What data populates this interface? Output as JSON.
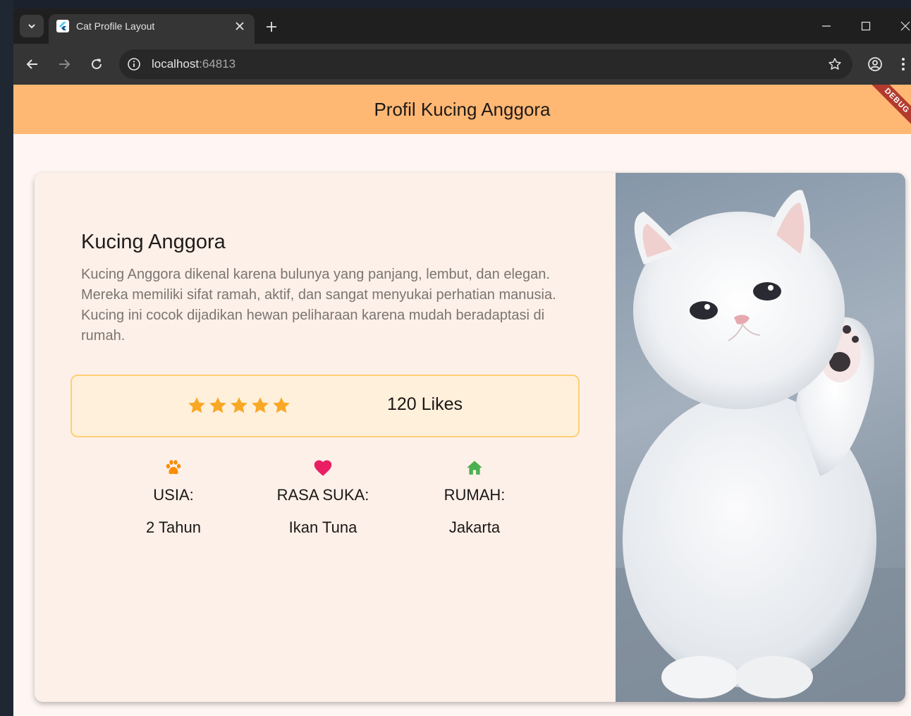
{
  "browser": {
    "tab_title": "Cat Profile Layout",
    "url_host": "localhost",
    "url_port": ":64813"
  },
  "app": {
    "appbar_title": "Profil Kucing Anggora",
    "debug_banner": "DEBUG",
    "appbar_color": "#ffb874",
    "background_color": "#fff6f3"
  },
  "profile": {
    "name": "Kucing Anggora",
    "description": "Kucing Anggora dikenal karena bulunya yang panjang, lembut, dan elegan. Mereka memiliki sifat ramah, aktif, dan sangat menyukai perhatian manusia. Kucing ini cocok dijadikan hewan peliharaan karena mudah beradaptasi di rumah.",
    "rating_stars": 5,
    "likes": "120 Likes",
    "star_color": "#f9a825"
  },
  "info": [
    {
      "icon": "paw-icon",
      "icon_color": "#fb8c00",
      "label": "USIA:",
      "value": "2 Tahun"
    },
    {
      "icon": "heart-icon",
      "icon_color": "#e91e63",
      "label": "RASA SUKA:",
      "value": "Ikan Tuna"
    },
    {
      "icon": "home-icon",
      "icon_color": "#4caf50",
      "label": "RUMAH:",
      "value": "Jakarta"
    }
  ]
}
